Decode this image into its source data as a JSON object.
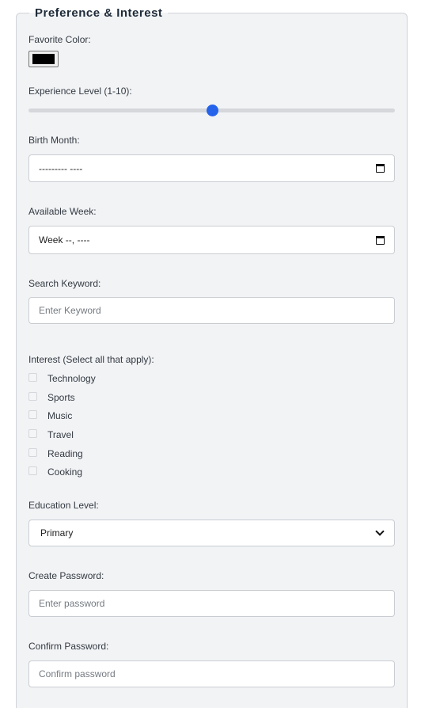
{
  "section": {
    "title": "Preference & Interest"
  },
  "favorite_color": {
    "label": "Favorite Color:",
    "value": "#000000"
  },
  "experience": {
    "label": "Experience Level (1-10):",
    "min": 1,
    "max": 10,
    "value": 5.5
  },
  "birth_month": {
    "label": "Birth Month:",
    "display": "--------- ----",
    "icon": "calendar-icon"
  },
  "available_week": {
    "label": "Available Week:",
    "display": "Week --, ----",
    "icon": "calendar-icon"
  },
  "search": {
    "label": "Search Keyword:",
    "placeholder": "Enter Keyword"
  },
  "interest": {
    "label": "Interest (Select all that apply):",
    "options": [
      {
        "label": "Technology",
        "checked": false
      },
      {
        "label": "Sports",
        "checked": false
      },
      {
        "label": "Music",
        "checked": false
      },
      {
        "label": "Travel",
        "checked": false
      },
      {
        "label": "Reading",
        "checked": false
      },
      {
        "label": "Cooking",
        "checked": false
      }
    ]
  },
  "education": {
    "label": "Education Level:",
    "selected": "Primary",
    "icon": "chevron-down-icon"
  },
  "password": {
    "label": "Create Password:",
    "placeholder": "Enter password"
  },
  "confirm_password": {
    "label": "Confirm Password:",
    "placeholder": "Confirm password"
  }
}
